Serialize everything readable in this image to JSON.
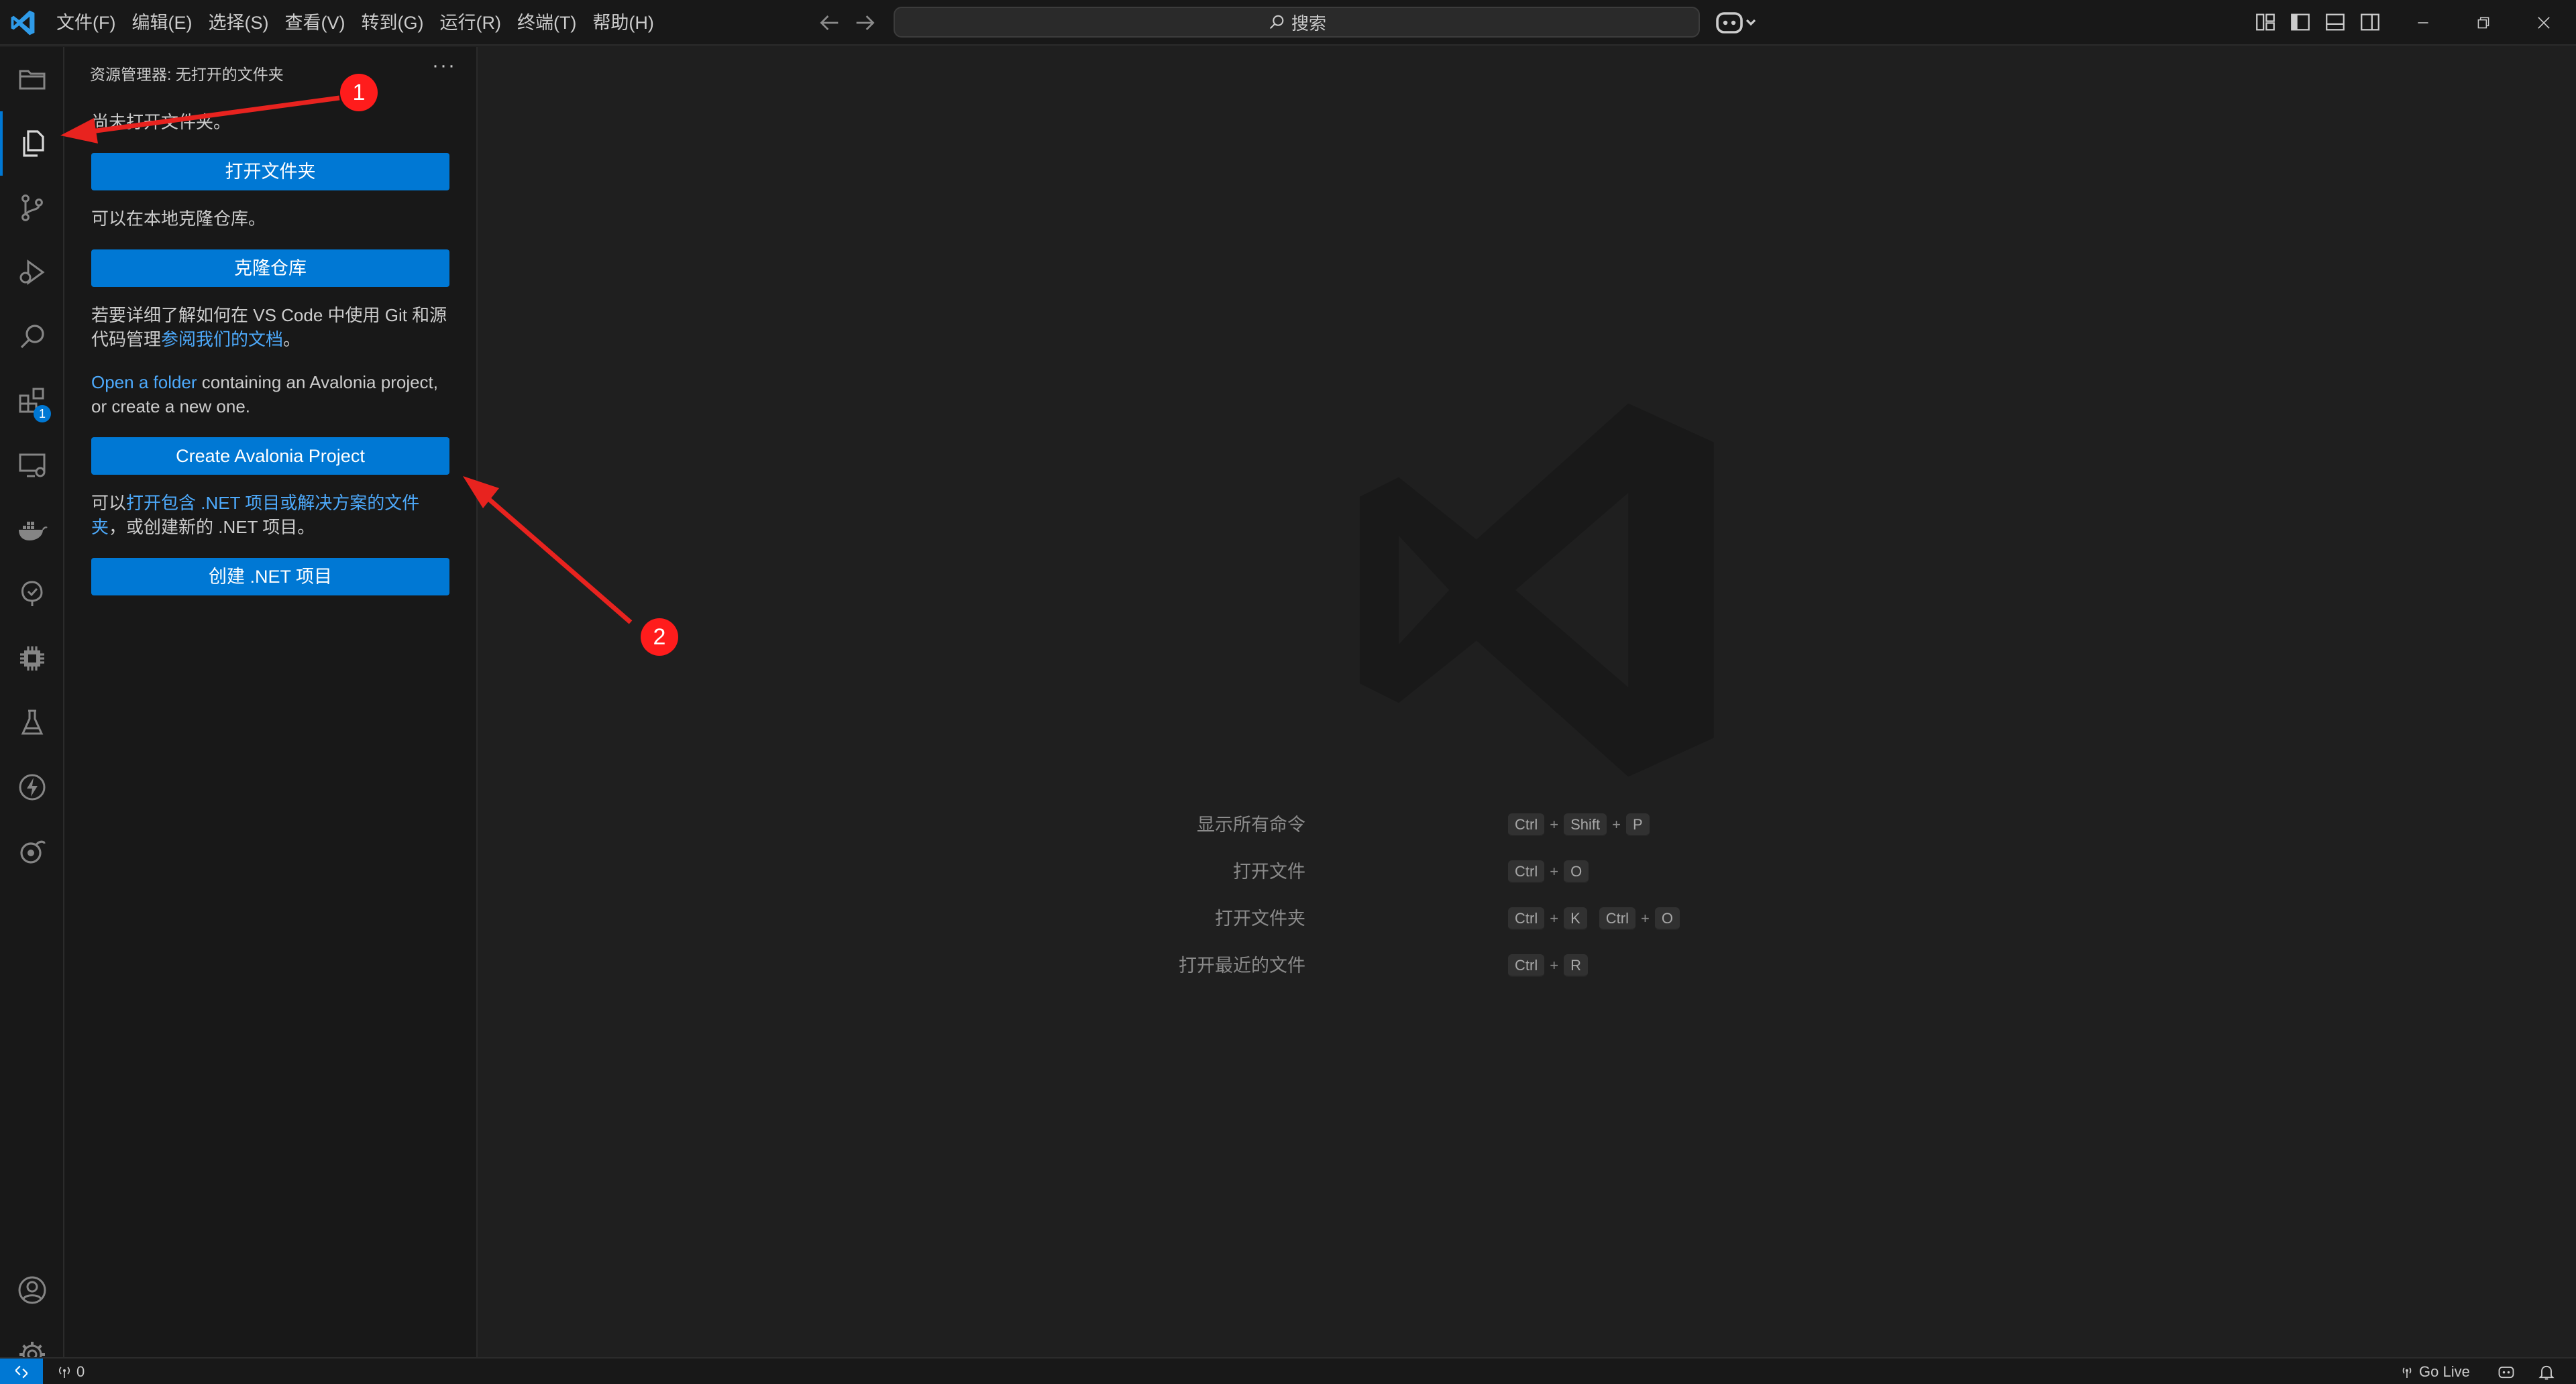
{
  "titlebar": {
    "menus": [
      "文件(F)",
      "编辑(E)",
      "选择(S)",
      "查看(V)",
      "转到(G)",
      "运行(R)",
      "终端(T)",
      "帮助(H)"
    ],
    "search_label": "搜索"
  },
  "activitybar": {
    "items": [
      "folder-icon",
      "explorer-icon",
      "source-control-icon",
      "run-debug-icon",
      "search-icon",
      "extensions-icon",
      "remote-explorer-icon",
      "docker-icon",
      "tree-check-icon",
      "chip-icon",
      "testing-icon",
      "lightning-icon",
      "browser-icon"
    ],
    "extensions_badge": "1",
    "bottom_items": [
      "account-icon",
      "settings-gear-icon"
    ]
  },
  "sidebar": {
    "title": "资源管理器: 无打开的文件夹",
    "no_folder_text": "尚未打开文件夹。",
    "open_folder_button": "打开文件夹",
    "clone_text": "可以在本地克隆仓库。",
    "clone_button": "克隆仓库",
    "git_text_1": "若要详细了解如何在 VS Code 中使用 Git 和源",
    "git_text_2": "代码管理",
    "git_link": "参阅我们的文档",
    "git_text_3": "。",
    "avalonia_link": "Open a folder",
    "avalonia_text_1": " containing an Avalonia project,",
    "avalonia_text_2": "or create a new one.",
    "avalonia_button": "Create Avalonia Project",
    "dotnet_text_1": "可以",
    "dotnet_link_1": "打开包含 .NET 项目或解决方案的文件",
    "dotnet_link_2": "夹",
    "dotnet_text_2": "，或创建新的 .NET 项目。",
    "dotnet_button": "创建 .NET 项目"
  },
  "editor": {
    "shortcuts": [
      {
        "label": "显示所有命令",
        "keys": [
          [
            "Ctrl",
            "Shift",
            "P"
          ]
        ]
      },
      {
        "label": "打开文件",
        "keys": [
          [
            "Ctrl",
            "O"
          ]
        ]
      },
      {
        "label": "打开文件夹",
        "keys": [
          [
            "Ctrl",
            "K"
          ],
          [
            "Ctrl",
            "O"
          ]
        ]
      },
      {
        "label": "打开最近的文件",
        "keys": [
          [
            "Ctrl",
            "R"
          ]
        ]
      }
    ]
  },
  "statusbar": {
    "ports_count": "0",
    "go_live": "Go Live"
  },
  "annotations": {
    "marker_1": "1",
    "marker_2": "2",
    "arrow_color": "#e8231f"
  },
  "colors": {
    "accent": "#0078d4",
    "link": "#4daafc",
    "background": "#1f1f1f",
    "sidebar_bg": "#181818"
  }
}
